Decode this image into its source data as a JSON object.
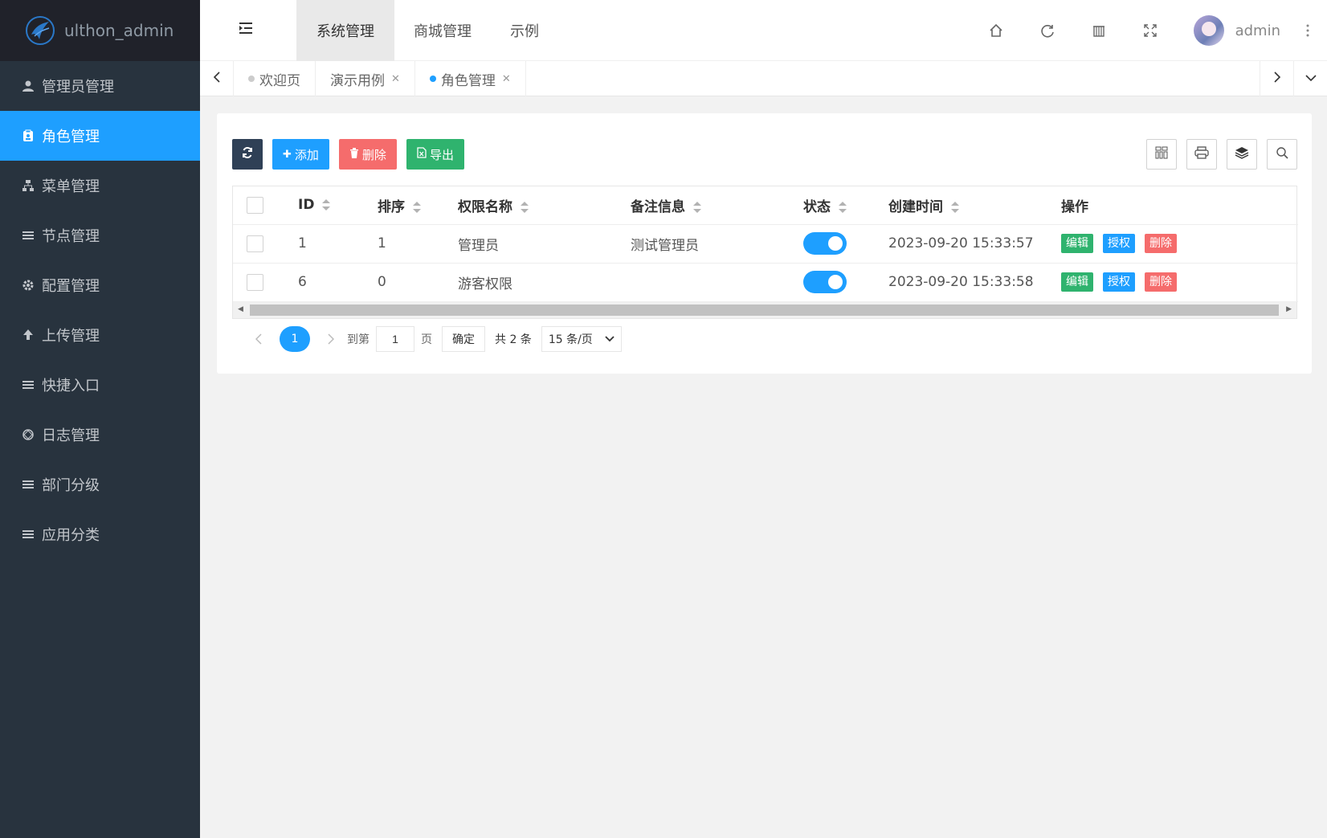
{
  "brand": {
    "name": "ulthon_admin"
  },
  "sidebar": {
    "items": [
      {
        "label": "管理员管理",
        "icon": "user-icon"
      },
      {
        "label": "角色管理",
        "icon": "clipboard-icon",
        "active": true
      },
      {
        "label": "菜单管理",
        "icon": "tree-icon"
      },
      {
        "label": "节点管理",
        "icon": "list-icon"
      },
      {
        "label": "配置管理",
        "icon": "gear-icon"
      },
      {
        "label": "上传管理",
        "icon": "upload-icon"
      },
      {
        "label": "快捷入口",
        "icon": "list-icon"
      },
      {
        "label": "日志管理",
        "icon": "connections-icon"
      },
      {
        "label": "部门分级",
        "icon": "list-icon"
      },
      {
        "label": "应用分类",
        "icon": "list-icon"
      }
    ]
  },
  "header": {
    "nav": [
      "系统管理",
      "商城管理",
      "示例"
    ],
    "active_nav": "系统管理",
    "user": "admin"
  },
  "tabs": {
    "items": [
      {
        "label": "欢迎页",
        "closable": false
      },
      {
        "label": "演示用例",
        "closable": true
      },
      {
        "label": "角色管理",
        "closable": true,
        "active": true
      }
    ]
  },
  "toolbar": {
    "add": "添加",
    "delete": "删除",
    "export": "导出"
  },
  "table": {
    "columns": [
      "ID",
      "排序",
      "权限名称",
      "备注信息",
      "状态",
      "创建时间",
      "操作"
    ],
    "rows": [
      {
        "id": "1",
        "sort": "1",
        "name": "管理员",
        "remark": "测试管理员",
        "status": true,
        "created": "2023-09-20 15:33:57"
      },
      {
        "id": "6",
        "sort": "0",
        "name": "游客权限",
        "remark": "",
        "status": true,
        "created": "2023-09-20 15:33:58"
      }
    ],
    "actions": {
      "edit": "编辑",
      "auth": "授权",
      "delete": "删除"
    }
  },
  "pagination": {
    "current": "1",
    "goto_label": "到第",
    "goto_value": "1",
    "page_label": "页",
    "confirm": "确定",
    "total": "共 2 条",
    "page_size": "15 条/页"
  },
  "colors": {
    "sidebar_bg": "#28333e",
    "accent": "#1e9fff",
    "success": "#2fb36e",
    "danger": "#f56c6c",
    "dark_btn": "#2f4056"
  }
}
